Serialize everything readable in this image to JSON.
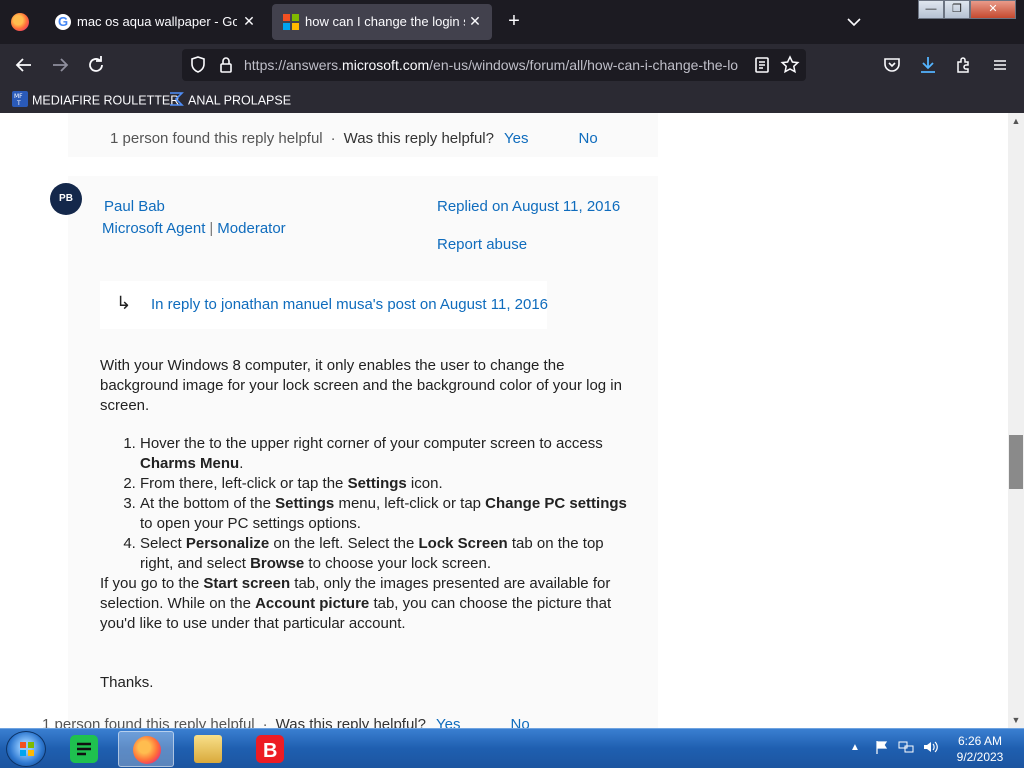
{
  "tabs": [
    {
      "title": "mac os aqua wallpaper - Googl",
      "close": "✕",
      "favicon": "google-g-icon"
    },
    {
      "title": "how can I change the login scre",
      "close": "✕",
      "favicon": "microsoft-logo-icon"
    }
  ],
  "new_tab_label": "+",
  "window_controls": {
    "minimize": "—",
    "restore": "❐",
    "close": "✕"
  },
  "url": {
    "prefix": "https://answers.",
    "domain": "microsoft.com",
    "path": "/en-us/windows/forum/all/how-can-i-change-the-lo"
  },
  "bookmarks": [
    {
      "label": "MEDIAFIRE ROULETTER",
      "icon": "mediafire-icon"
    },
    {
      "label": "ANAL PROLAPSE",
      "icon": "sigma-icon"
    }
  ],
  "top_helpful": {
    "count_text": "1 person found this reply helpful",
    "dot": "·",
    "question": "Was this reply helpful?",
    "yes": "Yes",
    "no": "No"
  },
  "post": {
    "avatar_initials": "PB",
    "author": "Paul Bab",
    "role1": "Microsoft Agent",
    "role_sep": "|",
    "role2": "Moderator",
    "replied": "Replied on August 11, 2016",
    "report": "Report abuse",
    "in_reply_arrow": "↳",
    "in_reply": "In reply to jonathan manuel musa's post on August 11, 2016",
    "intro": "With your Windows 8 computer, it only enables the user to change the background image for your lock screen and the background color of your log in screen.",
    "steps": [
      {
        "a": "Hover the to the upper right corner of your computer screen to access ",
        "b": "Charms Menu",
        "c": "."
      },
      {
        "a": "From there, left-click or tap the ",
        "b": "Settings",
        "c": " icon."
      },
      {
        "a": "At the bottom of the ",
        "b": "Settings",
        "c": " menu, left-click or tap ",
        "d": "Change PC settings",
        "e": " to open your PC settings options."
      },
      {
        "a": "Select ",
        "b": "Personalize",
        "c": " on the left. Select the ",
        "d": "Lock Screen",
        "e": " tab on the top right, and select ",
        "f": "Browse",
        "g": " to choose your lock screen."
      }
    ],
    "outro": {
      "a": "If you go to the ",
      "b": "Start screen",
      "c": " tab, only the images presented are available for selection. While on the ",
      "d": "Account picture",
      "e": " tab, you can choose the picture that you'd like to use under that particular account."
    },
    "thanks": "Thanks."
  },
  "bottom_helpful": {
    "count_text": "1 person found this reply helpful",
    "dot": "·",
    "question": "Was this reply helpful?",
    "yes": "Yes",
    "no": "No"
  },
  "clock": {
    "time": "6:26 AM",
    "date": "9/2/2023"
  },
  "colors": {
    "link": "#0f6cbd",
    "chrome_dark": "#1c1b22",
    "toolbar": "#2b2a33",
    "taskbar": "#1f5fb0"
  }
}
